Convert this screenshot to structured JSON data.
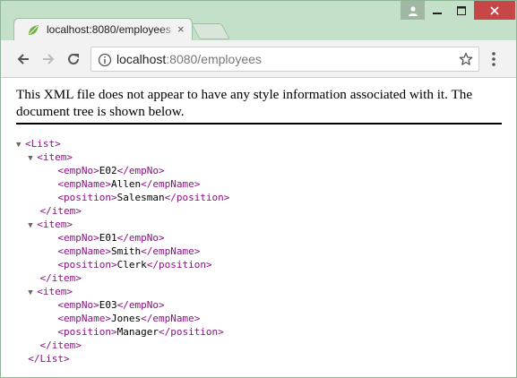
{
  "browser": {
    "tab_title": "localhost:8080/employees",
    "address_host": "localhost",
    "address_path": ":8080/employees"
  },
  "page": {
    "notice": "This XML file does not appear to have any style information associated with it. The document tree is shown below."
  },
  "xml": {
    "root_open": "<List>",
    "root_close": "</List>",
    "item_open": "<item>",
    "item_close": "</item>",
    "items": [
      {
        "empNo": {
          "open": "<empNo>",
          "value": "E02",
          "close": "</empNo>"
        },
        "empName": {
          "open": "<empName>",
          "value": "Allen",
          "close": "</empName>"
        },
        "position": {
          "open": "<position>",
          "value": "Salesman",
          "close": "</position>"
        }
      },
      {
        "empNo": {
          "open": "<empNo>",
          "value": "E01",
          "close": "</empNo>"
        },
        "empName": {
          "open": "<empName>",
          "value": "Smith",
          "close": "</empName>"
        },
        "position": {
          "open": "<position>",
          "value": "Clerk",
          "close": "</position>"
        }
      },
      {
        "empNo": {
          "open": "<empNo>",
          "value": "E03",
          "close": "</empNo>"
        },
        "empName": {
          "open": "<empName>",
          "value": "Jones",
          "close": "</empName>"
        },
        "position": {
          "open": "<position>",
          "value": "Manager",
          "close": "</position>"
        }
      }
    ]
  },
  "colors": {
    "tag": "#881280",
    "titlebar": "#c4e0c8",
    "close_button": "#c74647"
  },
  "icons": {
    "collapse": "▼"
  }
}
